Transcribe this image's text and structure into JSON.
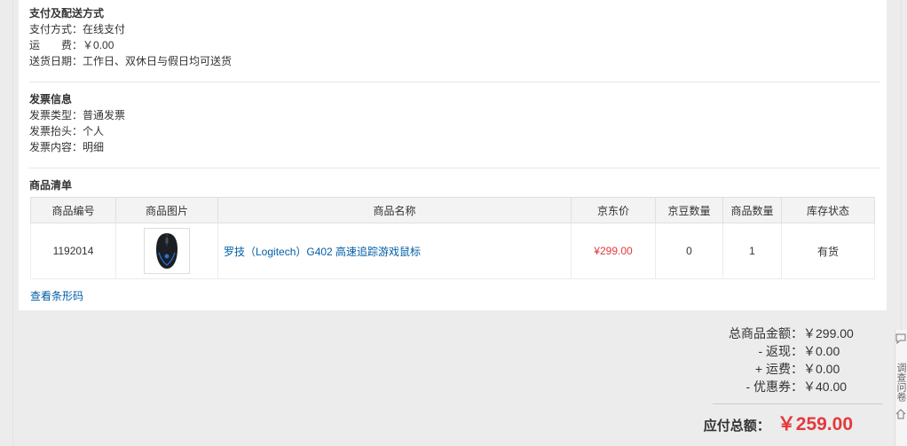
{
  "payment": {
    "title": "支付及配送方式",
    "method_label": "支付方式：",
    "method_value": "在线支付",
    "shipping_label": "运　　费：",
    "shipping_value": "￥0.00",
    "date_label": "送货日期：",
    "date_value": "工作日、双休日与假日均可送货"
  },
  "invoice": {
    "title": "发票信息",
    "type_label": "发票类型：",
    "type_value": "普通发票",
    "header_label": "发票抬头：",
    "header_value": "个人",
    "content_label": "发票内容：",
    "content_value": "明细"
  },
  "goods": {
    "title": "商品清单",
    "columns": [
      "商品编号",
      "商品图片",
      "商品名称",
      "京东价",
      "京豆数量",
      "商品数量",
      "库存状态"
    ],
    "rows": [
      {
        "id": "1192014",
        "name": "罗技（Logitech）G402 高速追踪游戏鼠标",
        "price": "¥299.00",
        "beans": "0",
        "qty": "1",
        "stock": "有货"
      }
    ],
    "barcode_link": "查看条形码"
  },
  "summary": {
    "subtotal_label": "总商品金额：",
    "subtotal_value": "￥299.00",
    "rebate_label": "- 返现：",
    "rebate_value": "￥0.00",
    "shipping_label": "+ 运费：",
    "shipping_value": "￥0.00",
    "coupon_label": "- 优惠券：",
    "coupon_value": "￥40.00",
    "total_label": "应付总额：",
    "total_value": "￥259.00"
  },
  "side_widget": {
    "text": "调查问卷"
  },
  "colors": {
    "price_red": "#e4393c",
    "link_blue": "#005ea7"
  },
  "icons": [
    "mouse-product-image",
    "chat-icon",
    "home-icon"
  ]
}
